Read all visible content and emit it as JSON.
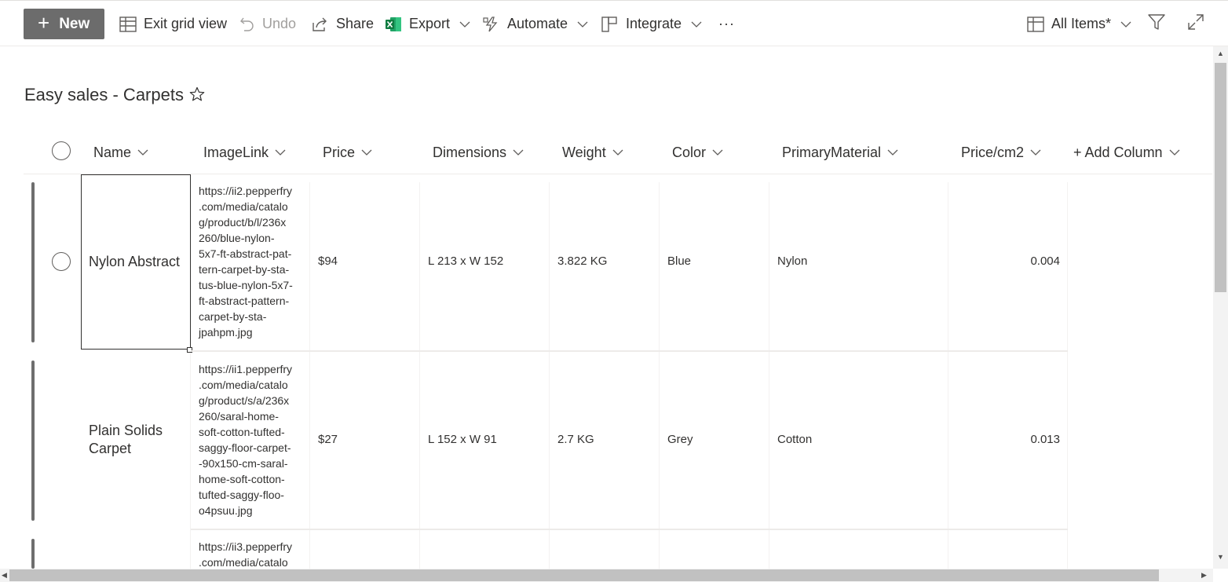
{
  "commandbar": {
    "new_label": "New",
    "exit_grid_label": "Exit grid view",
    "undo_label": "Undo",
    "share_label": "Share",
    "export_label": "Export",
    "automate_label": "Automate",
    "integrate_label": "Integrate",
    "more_label": "···",
    "view_label": "All Items*"
  },
  "page": {
    "title": "Easy sales - Carpets"
  },
  "columns": [
    "Name",
    "ImageLink",
    "Price",
    "Dimensions",
    "Weight",
    "Color",
    "PrimaryMaterial",
    "Price/cm2",
    "+ Add Column"
  ],
  "rows": [
    {
      "name": "Nylon Abstract",
      "imagelink": "https://ii2.pepperfry.com/media/catalog/product/b/l/236x260/blue-nylon-5x7-ft-abstract-pattern-carpet-by-status-blue-nylon-5x7-ft-abstract-pattern-carpet-by-sta-jpahpm.jpg",
      "imagelink_lines": [
        "https://ii2.pepperfry",
        ".com/media/catalo",
        "g/product/b/l/236x",
        "260/blue-nylon-",
        "5x7-ft-abstract-pat-",
        "tern-carpet-by-sta-",
        "tus-blue-nylon-5x7-",
        "ft-abstract-pattern-",
        "carpet-by-sta-",
        "jpahpm.jpg"
      ],
      "price": "$94",
      "dimensions": "L 213 x W 152",
      "weight": "3.822 KG",
      "color": "Blue",
      "material": "Nylon",
      "price_cm2": "0.004"
    },
    {
      "name_lines": [
        "Plain Solids",
        "Carpet"
      ],
      "imagelink": "https://ii1.pepperfry.com/media/catalog/product/s/a/236x260/saral-home-soft-cotton-tufted-saggy-floor-carpet--90x150-cm-saral-home-soft-cotton-tufted-saggy-floo-o4psuu.jpg",
      "imagelink_lines": [
        "https://ii1.pepperfry",
        ".com/media/catalo",
        "g/product/s/a/236x",
        "260/saral-home-",
        "soft-cotton-tufted-",
        "saggy-floor-carpet-",
        "-90x150-cm-saral-",
        "home-soft-cotton-",
        "tufted-saggy-floo-",
        "o4psuu.jpg"
      ],
      "price": "$27",
      "dimensions": "L 152 x W 91",
      "weight": "2.7 KG",
      "color": "Grey",
      "material": "Cotton",
      "price_cm2": "0.013"
    },
    {
      "imagelink_lines": [
        "https://ii3.pepperfry",
        ".com/media/catalo"
      ]
    }
  ]
}
